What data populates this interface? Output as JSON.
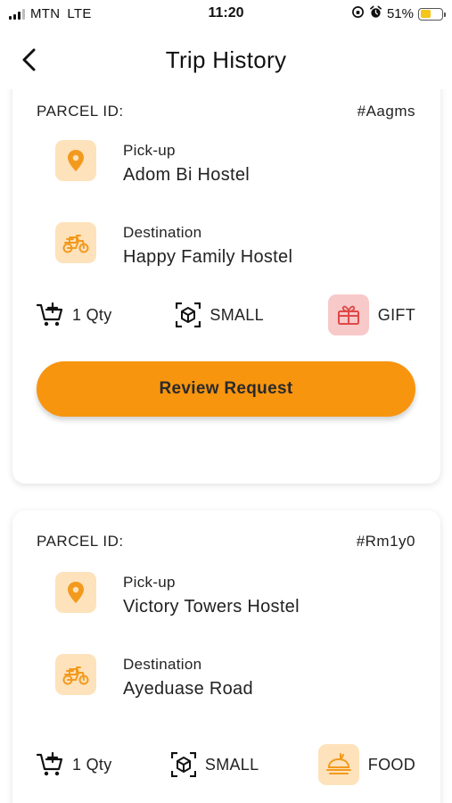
{
  "status_bar": {
    "carrier": "MTN",
    "network": "LTE",
    "time": "11:20",
    "battery_percent": "51%",
    "battery_level": 0.51
  },
  "header": {
    "title": "Trip History"
  },
  "colors": {
    "accent": "#f7950f",
    "icon_bg_orange": "#fde2bb",
    "icon_bg_red": "#f8c9c9",
    "icon_orange": "#f39a1e",
    "icon_red": "#e04848"
  },
  "parcels": [
    {
      "id_label": "PARCEL ID:",
      "id_value": "#Aagms",
      "pickup_label": "Pick-up",
      "pickup_value": "Adom Bi Hostel",
      "destination_label": "Destination",
      "destination_value": "Happy Family Hostel",
      "qty": "1 Qty",
      "size": "SMALL",
      "type": "GIFT",
      "type_icon": "gift-icon",
      "action_label": "Review Request"
    },
    {
      "id_label": "PARCEL ID:",
      "id_value": "#Rm1y0",
      "pickup_label": "Pick-up",
      "pickup_value": "Victory Towers Hostel",
      "destination_label": "Destination",
      "destination_value": "Ayeduase Road",
      "qty": "1 Qty",
      "size": "SMALL",
      "type": "FOOD",
      "type_icon": "food-icon"
    }
  ]
}
